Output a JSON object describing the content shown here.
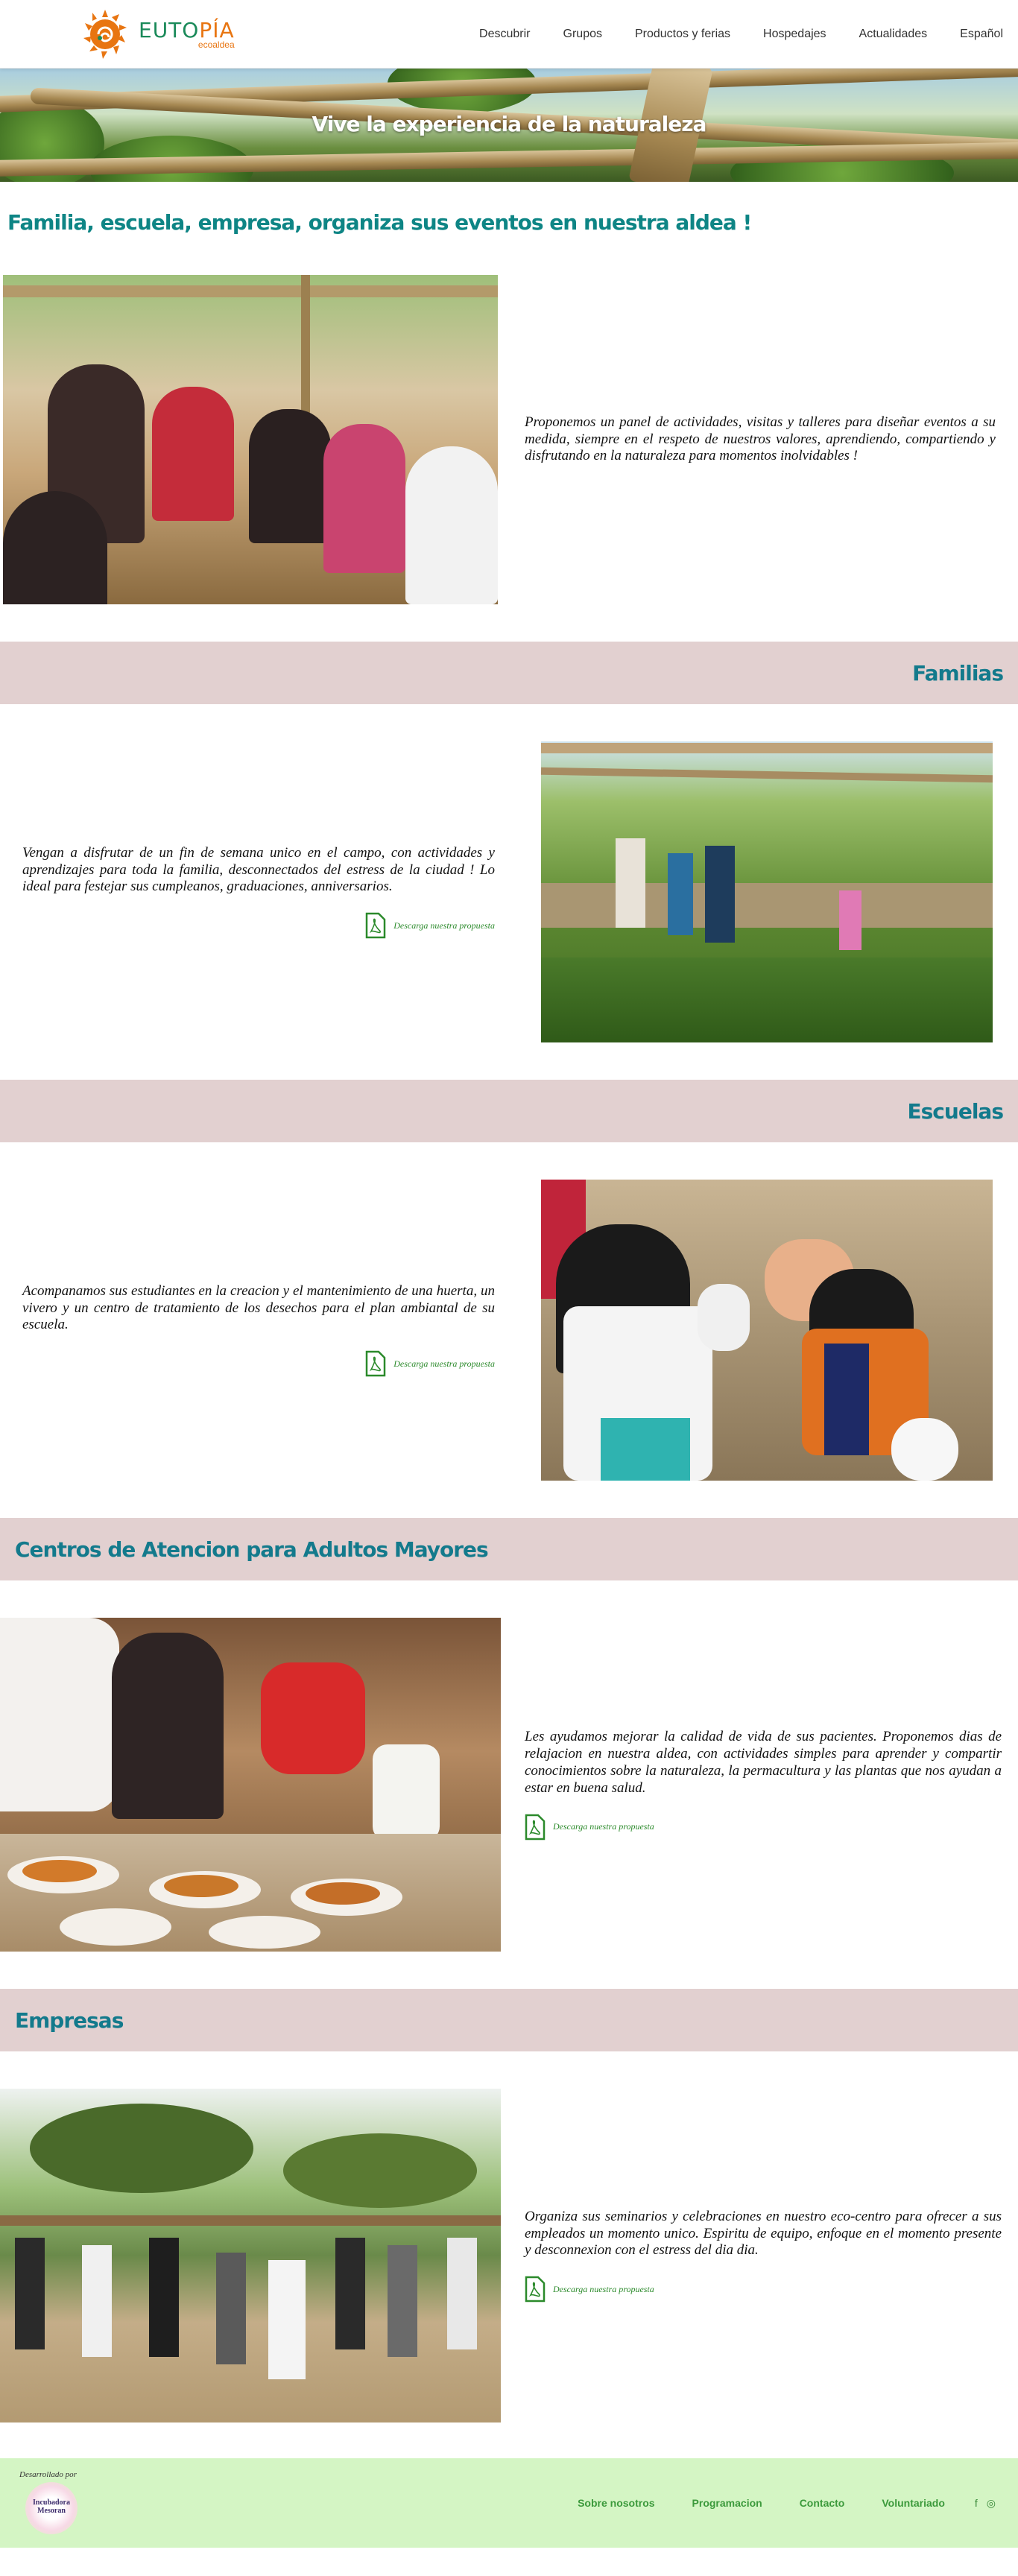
{
  "header": {
    "logo_text_main": "EUTO",
    "logo_text_accent": "PÍA",
    "logo_sub": "ecoaldea",
    "nav": [
      {
        "label": "Descubrir"
      },
      {
        "label": "Grupos"
      },
      {
        "label": "Productos y ferias"
      },
      {
        "label": "Hospedajes"
      },
      {
        "label": "Actualidades"
      },
      {
        "label": "Español"
      }
    ]
  },
  "hero": {
    "title": "Vive la experiencia de la naturaleza"
  },
  "intro": {
    "title": "Familia, escuela, empresa, organiza sus eventos en nuestra aldea !",
    "text": "Proponemos un panel de actividades, visitas y talleres para diseñar eventos a su medida, siempre en el respeto de nuestros valores, aprendiendo, compartiendo y disfrutando en la naturaleza para momentos inolvidables !"
  },
  "sections": [
    {
      "title": "Familias",
      "text": "Vengan a disfrutar de un fin de semana unico en el campo, con actividades y aprendizajes para toda la familia, desconnectados del estress de la ciudad ! Lo ideal para festejar sus cumpleanos, graduaciones, anniversarios.",
      "download": "Descarga nuestra propuesta"
    },
    {
      "title": "Escuelas",
      "text": "Acompanamos sus estudiantes en la creacion y el mantenimiento de una huerta, un vivero y un centro de tratamiento de los desechos para el plan ambiantal de su escuela.",
      "download": "Descarga nuestra propuesta"
    },
    {
      "title": "Centros de Atencion para Adultos Mayores",
      "text": "Les ayudamos mejorar la calidad de vida de sus pacientes. Proponemos dias de relajacion en nuestra aldea, con actividades simples para aprender y compartir conocimientos sobre la naturaleza, la permacultura y las plantas que nos ayudan a estar en buena salud.",
      "download": "Descarga nuestra propuesta"
    },
    {
      "title": "Empresas",
      "text": "Organiza sus seminarios y celebraciones en nuestro eco-centro para ofrecer a sus empleados un momento unico. Espiritu de equipo, enfoque en el momento presente y desconnexion con el estress del dia dia.",
      "download": "Descarga nuestra propuesta"
    }
  ],
  "footer": {
    "dev_label": "Desarrollado por",
    "dev_name": "Incubadora Mesoran",
    "links": [
      {
        "label": "Sobre nosotros"
      },
      {
        "label": "Programacion"
      },
      {
        "label": "Contacto"
      },
      {
        "label": "Voluntariado"
      }
    ],
    "social": [
      "f",
      "◎"
    ]
  },
  "colors": {
    "teal": "#0e8585",
    "band": "#e2d0d0",
    "footer": "#d4f5c4",
    "green": "#2b8a2b",
    "orange": "#e87511"
  }
}
